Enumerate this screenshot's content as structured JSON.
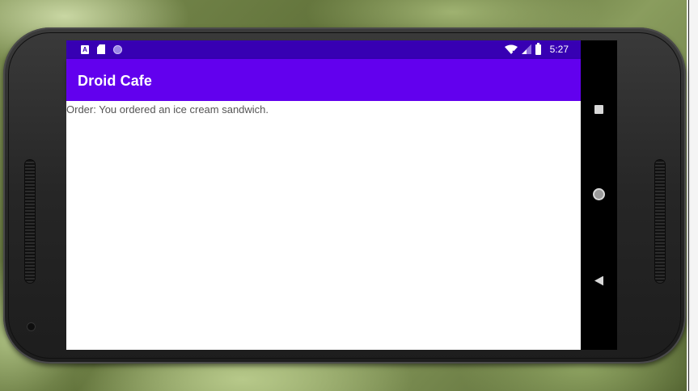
{
  "status_bar": {
    "left_icons": [
      "keyboard-a-icon",
      "sd-card-icon",
      "circle-notification-icon"
    ],
    "right_icons": [
      "wifi-icon",
      "signal-icon",
      "battery-icon"
    ],
    "time": "5:27",
    "color": "#3700b3"
  },
  "app_bar": {
    "title": "Droid Cafe",
    "color": "#6200ee"
  },
  "content": {
    "order_message": "Order: You ordered an ice cream sandwich."
  },
  "nav_bar": {
    "buttons": [
      "recents-icon",
      "home-icon",
      "back-icon"
    ]
  }
}
